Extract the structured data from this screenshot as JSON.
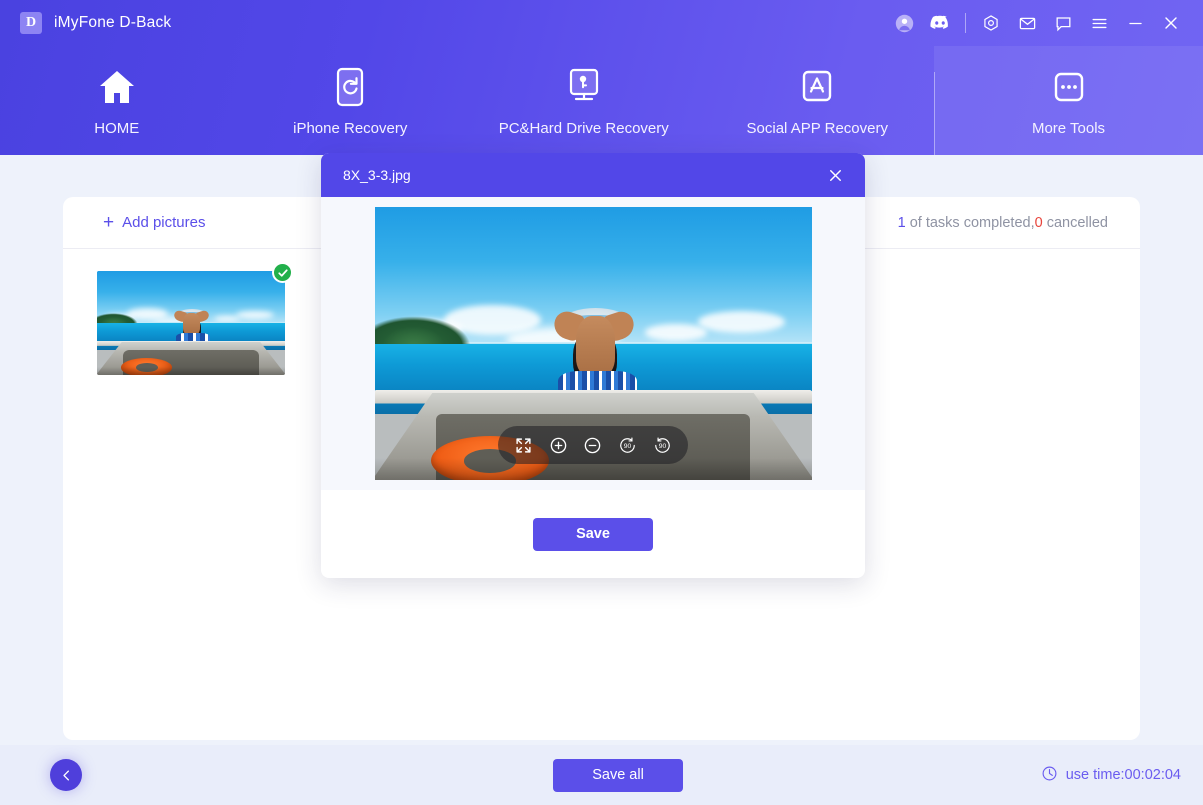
{
  "window": {
    "logo_letter": "D",
    "app_title": "iMyFone D-Back",
    "icons": [
      {
        "name": "account-avatar-icon"
      },
      {
        "name": "discord-icon"
      },
      {
        "name": "target-icon"
      },
      {
        "name": "mail-icon"
      },
      {
        "name": "feedback-chat-icon"
      },
      {
        "name": "menu-hamburger-icon"
      },
      {
        "name": "minimize-icon"
      },
      {
        "name": "close-icon"
      }
    ]
  },
  "nav": {
    "items": [
      {
        "label": "HOME",
        "icon": "home-icon"
      },
      {
        "label": "iPhone Recovery",
        "icon": "phone-refresh-icon"
      },
      {
        "label": "PC&Hard Drive Recovery",
        "icon": "monitor-key-icon"
      },
      {
        "label": "Social APP Recovery",
        "icon": "appstore-icon"
      }
    ],
    "more": {
      "label": "More Tools",
      "icon": "more-dots-icon"
    }
  },
  "card": {
    "add_pictures_label": "Add pictures",
    "add_plus": "+",
    "status": {
      "completed_count": "1",
      "middle_text": " of tasks completed,",
      "cancelled_count": "0",
      "cancelled_text": " cancelled"
    },
    "thumbnails": [
      {
        "name": "beach-boat-photo",
        "selected": true
      }
    ]
  },
  "modal": {
    "title": "8X_3-3.jpg",
    "close_icon": "close-icon",
    "controls": [
      {
        "name": "fullscreen-icon",
        "label": "fullscreen"
      },
      {
        "name": "zoom-in-icon",
        "label": "zoom in"
      },
      {
        "name": "zoom-out-icon",
        "label": "zoom out"
      },
      {
        "name": "rotate-left-90-icon",
        "label": "90"
      },
      {
        "name": "rotate-right-90-icon",
        "label": "90"
      }
    ],
    "save_label": "Save"
  },
  "footer": {
    "back_icon": "arrow-left-icon",
    "save_all_label": "Save all",
    "clock_icon": "clock-icon",
    "use_time_label": "use time:00:02:04"
  },
  "colors": {
    "brand_purple": "#5b4fe9",
    "header_gradient_start": "#4a42e0",
    "header_gradient_end": "#7165f3",
    "success_green": "#22b04b",
    "error_red": "#e8453c",
    "page_bg": "#eef2fb",
    "bottom_bar_bg": "#e9edfa"
  }
}
